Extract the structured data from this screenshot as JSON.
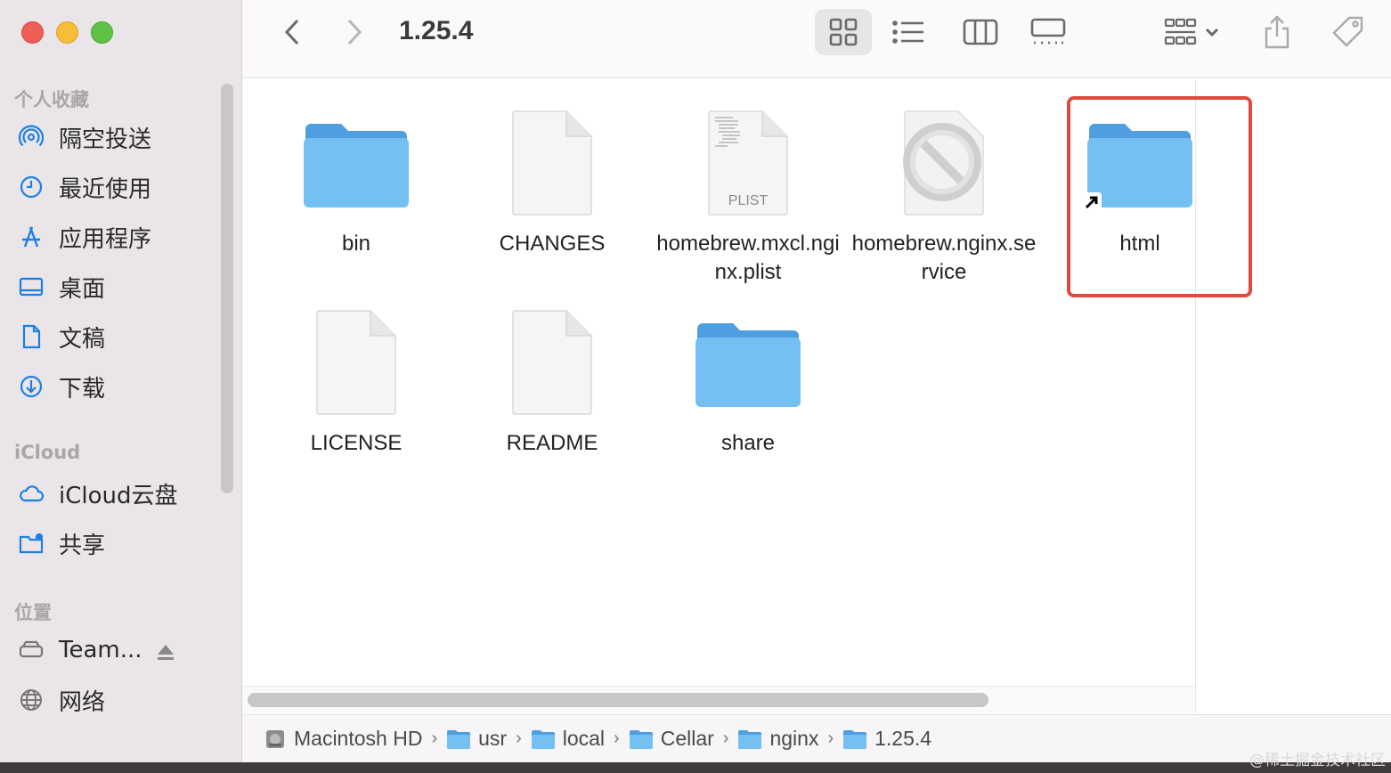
{
  "window": {
    "title": "1.25.4"
  },
  "sidebar": {
    "sections": [
      {
        "label": "个人收藏"
      },
      {
        "label": "iCloud"
      },
      {
        "label": "位置"
      }
    ],
    "favorites": [
      {
        "label": "隔空投送",
        "icon": "airdrop-icon"
      },
      {
        "label": "最近使用",
        "icon": "clock-icon"
      },
      {
        "label": "应用程序",
        "icon": "applications-icon"
      },
      {
        "label": "桌面",
        "icon": "desktop-icon"
      },
      {
        "label": "文稿",
        "icon": "document-icon"
      },
      {
        "label": "下载",
        "icon": "download-icon"
      }
    ],
    "icloud": [
      {
        "label": "iCloud云盘",
        "icon": "cloud-icon"
      },
      {
        "label": "共享",
        "icon": "shared-folder-icon"
      }
    ],
    "locations": [
      {
        "label": "Team...",
        "icon": "drive-icon"
      },
      {
        "label": "网络",
        "icon": "globe-icon"
      }
    ]
  },
  "files": [
    {
      "name": "bin",
      "type": "folder"
    },
    {
      "name": "CHANGES",
      "type": "file"
    },
    {
      "name": "homebrew.mxcl.nginx.plist",
      "type": "plist",
      "badge": "PLIST"
    },
    {
      "name": "homebrew.nginx.service",
      "type": "blocked"
    },
    {
      "name": "html",
      "type": "folder-alias"
    },
    {
      "name": "LICENSE",
      "type": "file"
    },
    {
      "name": "README",
      "type": "file"
    },
    {
      "name": "share",
      "type": "folder"
    }
  ],
  "pathbar": [
    {
      "label": "Macintosh HD",
      "icon": "hard-drive-icon"
    },
    {
      "label": "usr",
      "icon": "folder-icon"
    },
    {
      "label": "local",
      "icon": "folder-icon"
    },
    {
      "label": "Cellar",
      "icon": "folder-icon"
    },
    {
      "label": "nginx",
      "icon": "folder-icon"
    },
    {
      "label": "1.25.4",
      "icon": "folder-icon"
    }
  ],
  "pathbar_separator": "›",
  "watermark": "@稀土掘金技术社区",
  "colors": {
    "folder": "#6cb8ee",
    "highlight": "#e04a3a",
    "sidebar_bg": "#e9e5e8",
    "accent": "#1d7fe6"
  }
}
